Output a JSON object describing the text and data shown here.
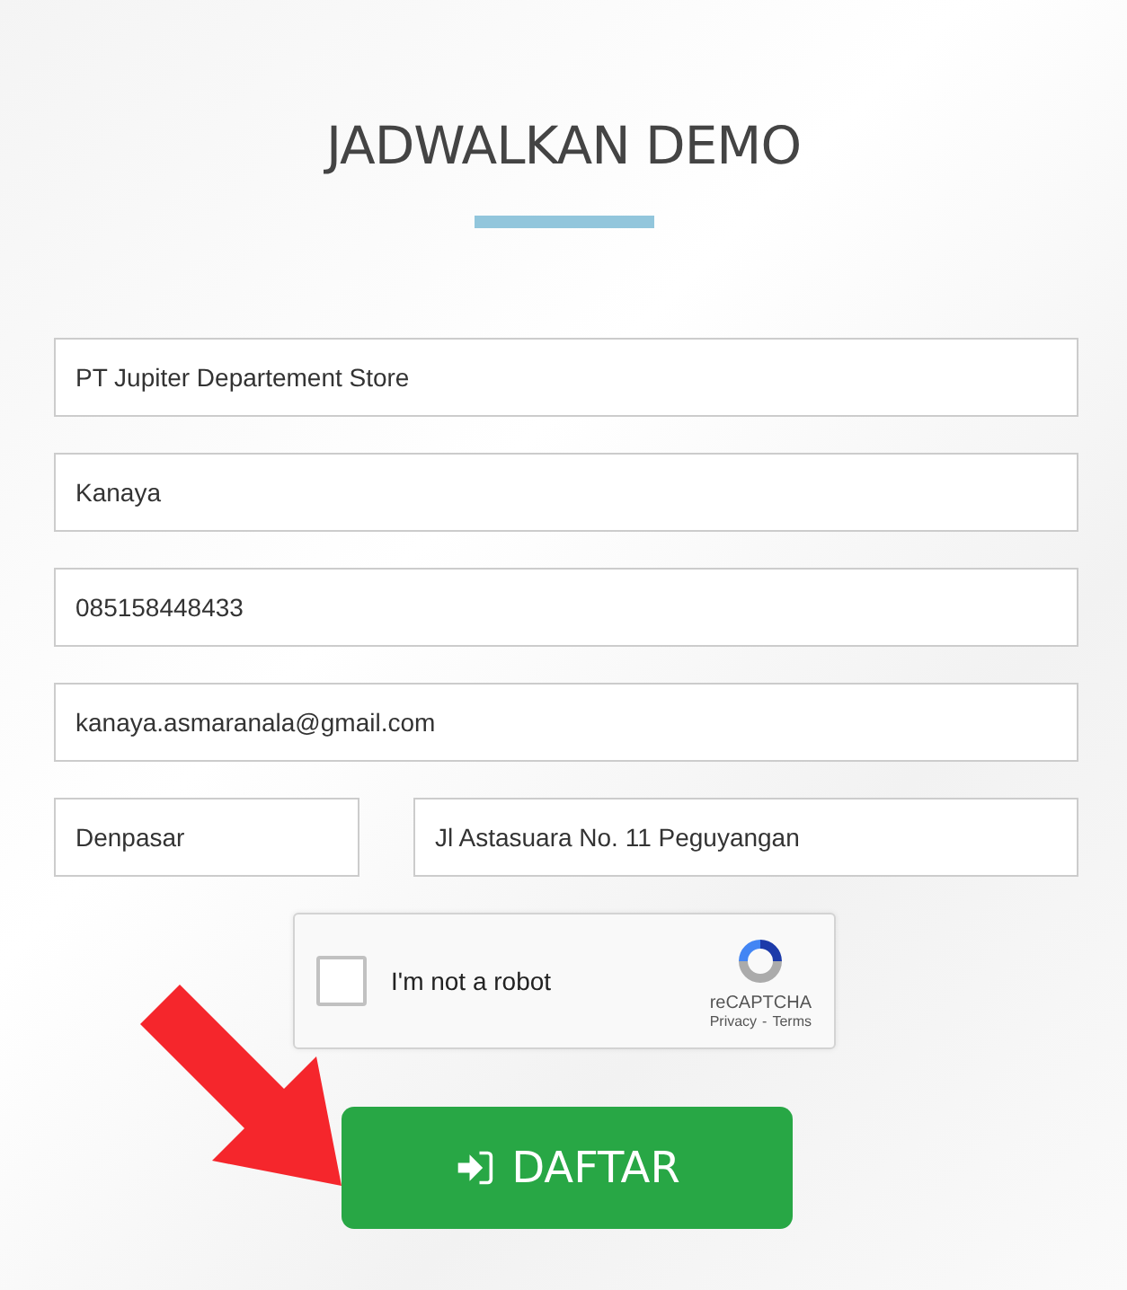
{
  "title": "JADWALKAN DEMO",
  "fields": [
    {
      "value": "PT Jupiter Departement Store"
    },
    {
      "value": "Kanaya"
    },
    {
      "value": "085158448433"
    },
    {
      "value": "kanaya.asmaranala@gmail.com"
    }
  ],
  "location_row": [
    {
      "value": "Denpasar"
    },
    {
      "value": "Jl Astasuara No. 11 Peguyangan"
    }
  ],
  "captcha": {
    "checked": false,
    "label": "I'm not a robot",
    "brand": "reCAPTCHA",
    "privacy": "Privacy",
    "separator": "-",
    "terms": "Terms"
  },
  "submit_button": {
    "label": "DAFTAR"
  }
}
